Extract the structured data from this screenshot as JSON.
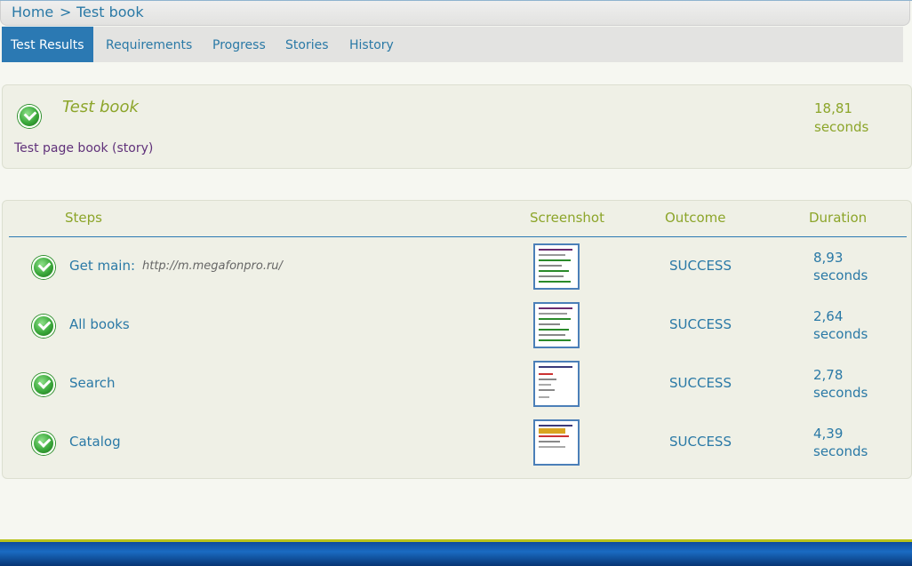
{
  "breadcrumb": {
    "home": "Home",
    "separator": ">",
    "current": "Test book"
  },
  "tabs": [
    {
      "label": "Test Results",
      "active": true
    },
    {
      "label": "Requirements",
      "active": false
    },
    {
      "label": "Progress",
      "active": false
    },
    {
      "label": "Stories",
      "active": false
    },
    {
      "label": "History",
      "active": false
    }
  ],
  "summary": {
    "icon": "success-check-icon",
    "title": "Test book",
    "story": "Test page book (story)",
    "duration_value": "18,81",
    "duration_unit": "seconds"
  },
  "steps_table": {
    "headers": {
      "steps": "Steps",
      "screenshot": "Screenshot",
      "outcome": "Outcome",
      "duration": "Duration"
    },
    "rows": [
      {
        "icon": "success-check-icon",
        "label": "Get main:",
        "url": "http://m.megafonpro.ru/",
        "outcome": "SUCCESS",
        "duration_value": "8,93",
        "duration_unit": "seconds"
      },
      {
        "icon": "success-check-icon",
        "label": "All books",
        "url": "",
        "outcome": "SUCCESS",
        "duration_value": "2,64",
        "duration_unit": "seconds"
      },
      {
        "icon": "success-check-icon",
        "label": "Search",
        "url": "",
        "outcome": "SUCCESS",
        "duration_value": "2,78",
        "duration_unit": "seconds"
      },
      {
        "icon": "success-check-icon",
        "label": "Catalog",
        "url": "",
        "outcome": "SUCCESS",
        "duration_value": "4,39",
        "duration_unit": "seconds"
      }
    ]
  },
  "colors": {
    "link_blue": "#2a79a6",
    "accent_green": "#8ca52a",
    "active_tab": "#2b79b3",
    "story_purple": "#60317a"
  }
}
